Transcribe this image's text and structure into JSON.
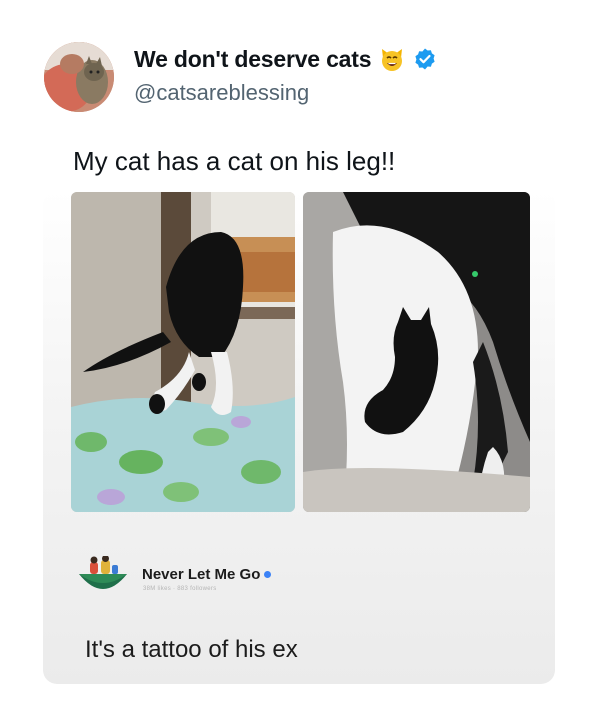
{
  "tweet": {
    "display_name": "We don't deserve cats",
    "handle": "@catsareblessing",
    "text": "My cat has a cat on his leg!!",
    "emoji_icon": "smiling-cat-emoji",
    "verified_icon": "verified-badge-icon",
    "verified_color": "#1d9bf0"
  },
  "embed": {
    "photos": [
      {
        "icon": "cat-photo-left"
      },
      {
        "icon": "cat-photo-right"
      }
    ],
    "quote": {
      "account_name": "Never Let Me Go",
      "meta": "38M likes · 883 followers",
      "text": "It's a tattoo of his ex",
      "status_dot_color": "#3b82f6"
    }
  },
  "colors": {
    "text_primary": "#0f1419",
    "text_secondary": "#536471"
  }
}
